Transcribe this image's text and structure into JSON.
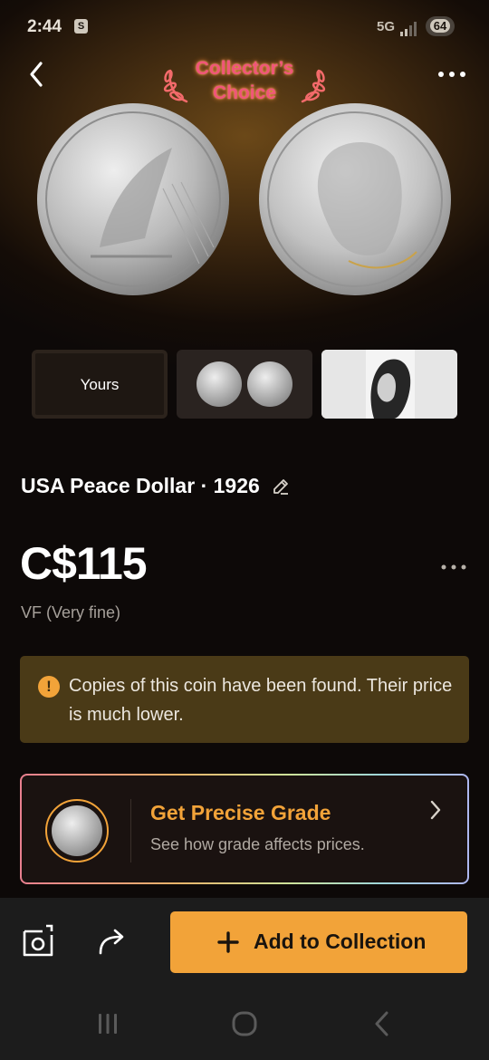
{
  "status_bar": {
    "time": "2:44",
    "sim_label": "S",
    "network": "5G",
    "battery": "64"
  },
  "header": {
    "badge_line1": "Collector’s",
    "badge_line2": "Choice",
    "back_icon": "chevron-left-icon",
    "more_icon": "more-horizontal-icon"
  },
  "thumbnails": {
    "yours_label": "Yours"
  },
  "coin": {
    "title": "USA Peace Dollar · 1926",
    "price": "C$115",
    "grade": "VF (Very fine)"
  },
  "warning": {
    "text": "Copies of this coin have been found. Their price is much lower."
  },
  "grade_card": {
    "title": "Get Precise Grade",
    "subtitle": "See how grade affects prices."
  },
  "actions": {
    "add_label": "Add to Collection"
  },
  "colors": {
    "accent": "#f2a339",
    "background": "#0d0908",
    "warning_bg": "#4a3a17",
    "badge_text": "#f0557a"
  }
}
